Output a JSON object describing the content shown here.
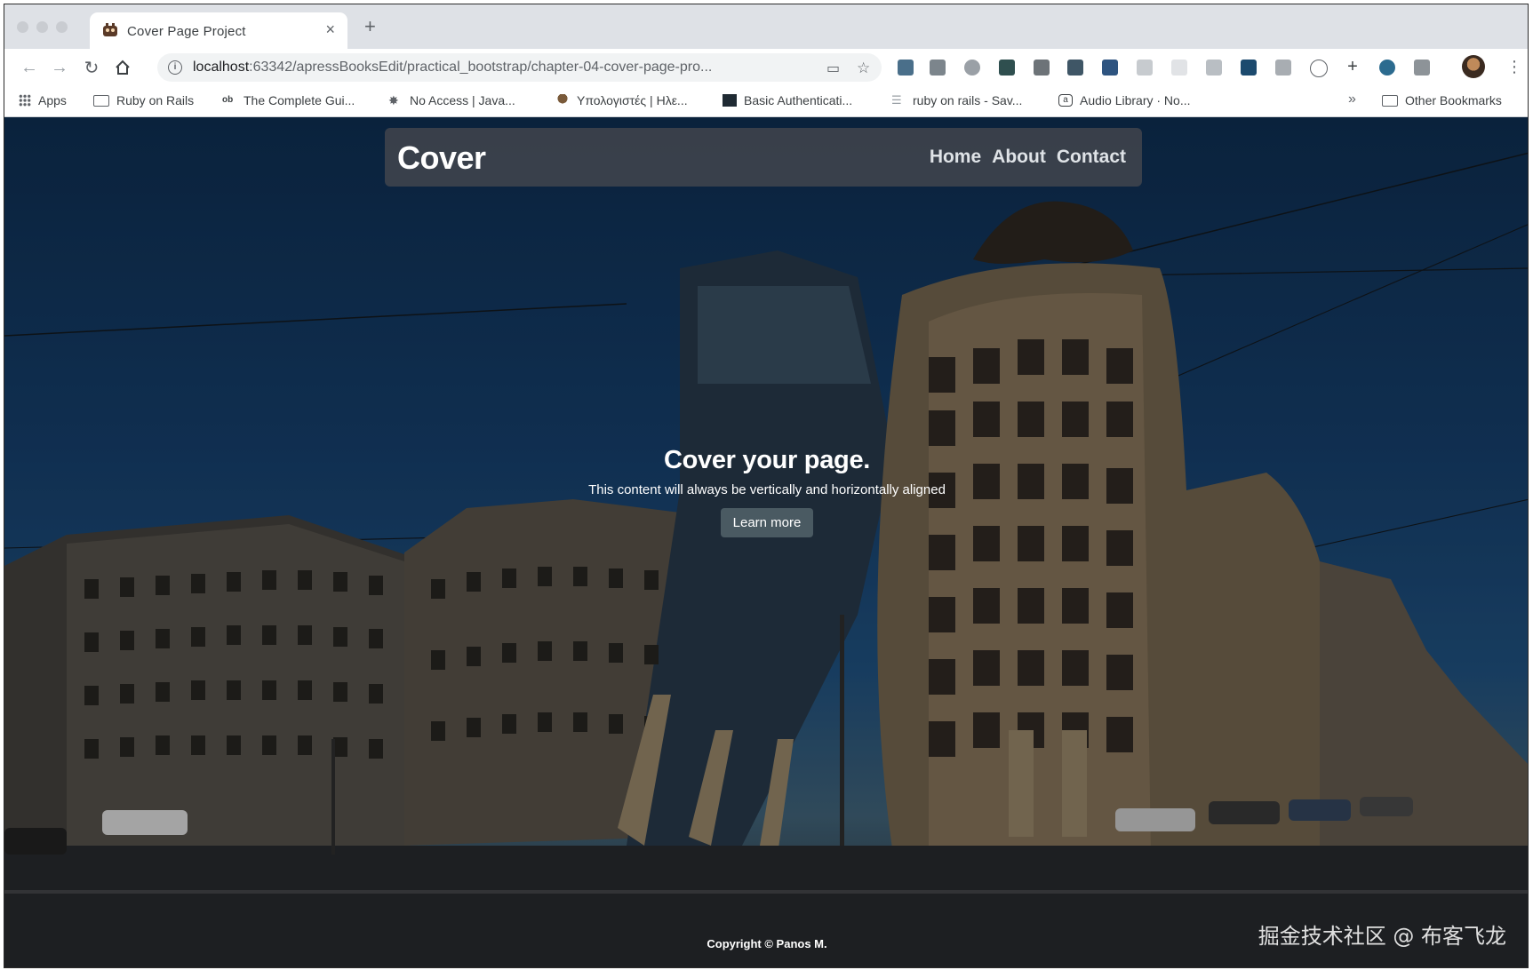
{
  "browser": {
    "tab_title": "Cover Page Project",
    "tab_close": "×",
    "new_tab": "+",
    "url_host": "localhost",
    "url_path": ":63342/apressBooksEdit/practical_bootstrap/chapter-04-cover-page-pro...",
    "bookmarks": [
      {
        "label": "Apps",
        "icon": "apps-grid-icon"
      },
      {
        "label": "Ruby on Rails",
        "icon": "folder-icon"
      },
      {
        "label": "The Complete Gui...",
        "icon": "ob-icon"
      },
      {
        "label": "No Access | Java...",
        "icon": "star-burst-icon"
      },
      {
        "label": "Υπολογιστές | Ηλε...",
        "icon": "tree-icon"
      },
      {
        "label": "Basic Authenticati...",
        "icon": "diamond-icon"
      },
      {
        "label": "ruby on rails - Sav...",
        "icon": "stack-icon"
      },
      {
        "label": "Audio Library · No...",
        "icon": "audio-icon"
      }
    ],
    "bookmarks_more": "»",
    "other_bookmarks": "Other Bookmarks"
  },
  "page": {
    "brand": "Cover",
    "nav": [
      "Home",
      "About",
      "Contact"
    ],
    "heading": "Cover your page.",
    "lead": "This content will always be vertically and horizontally aligned",
    "button": "Learn more",
    "footer": "Copyright © Panos M.",
    "watermark": "掘金技术社区 @ 布客飞龙"
  },
  "colors": {
    "header_bg": "#46484e",
    "button_bg": "#4a5a62",
    "sky_top": "#0d2a4a",
    "sky_mid": "#143a63"
  }
}
